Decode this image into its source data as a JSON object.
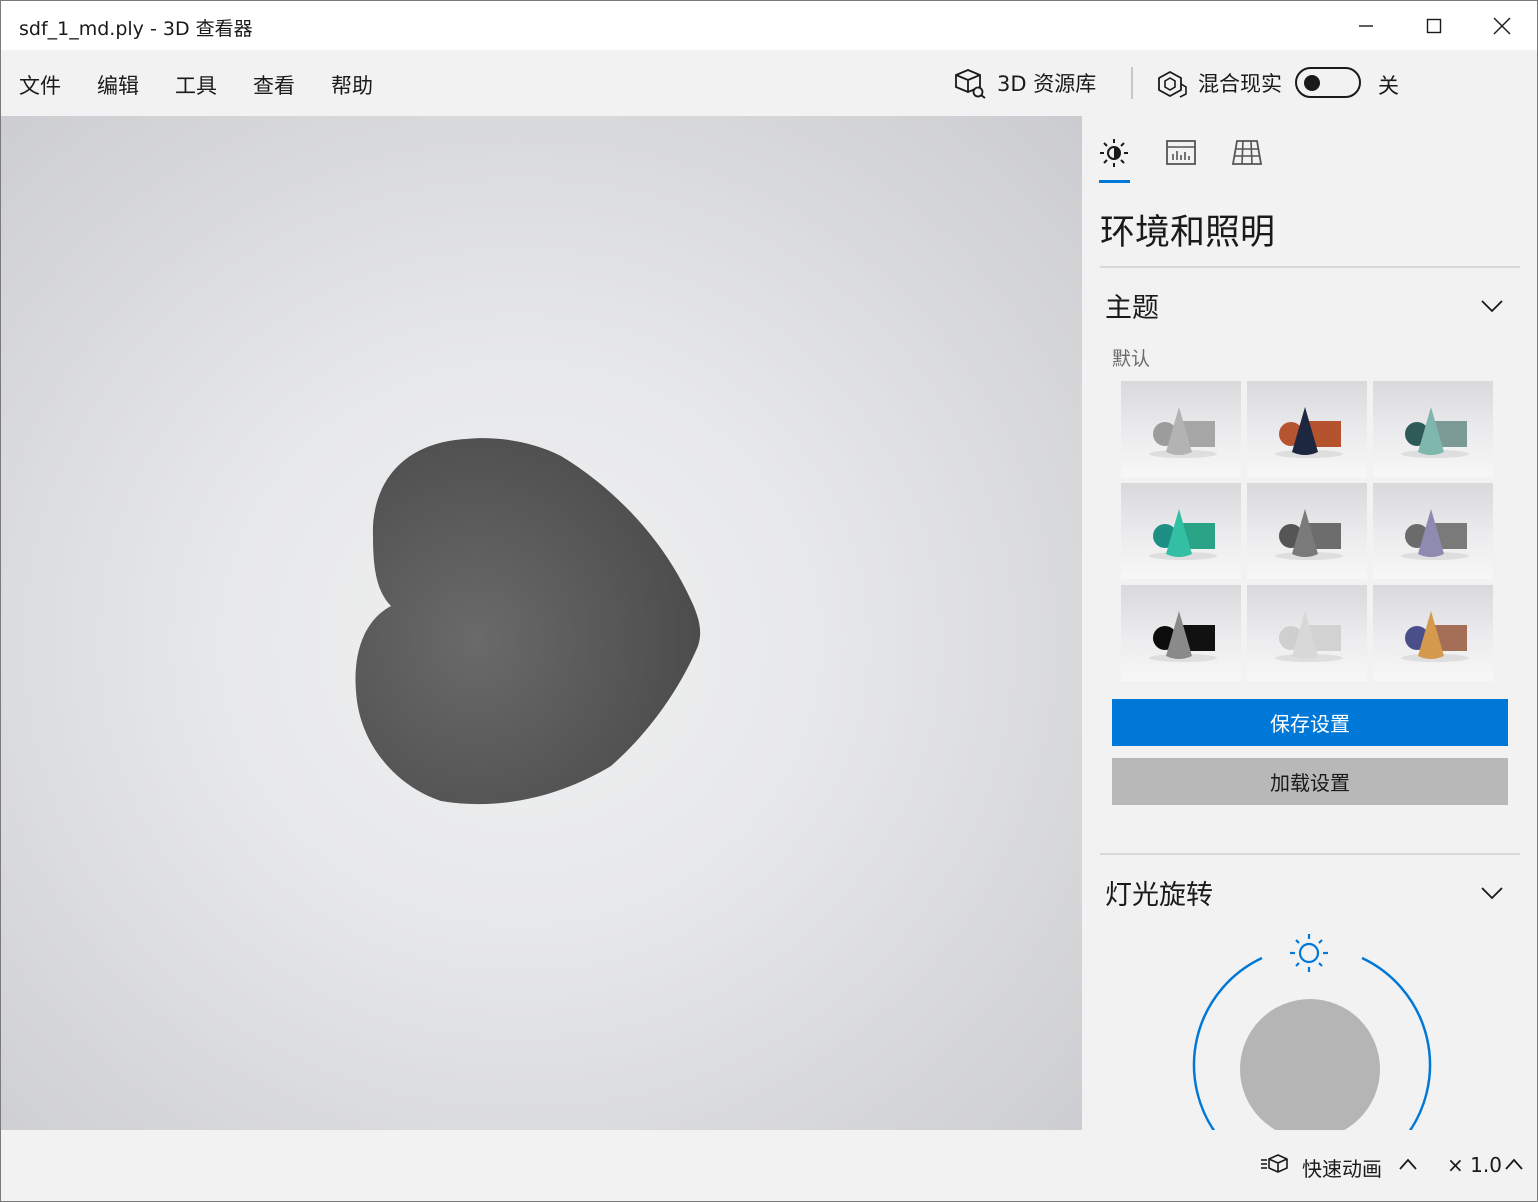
{
  "window": {
    "title": "sdf_1_md.ply - 3D 查看器"
  },
  "menu": {
    "items": [
      "文件",
      "编辑",
      "工具",
      "查看",
      "帮助"
    ],
    "library_label": "3D 资源库",
    "mixed_reality_label": "混合现实",
    "mixed_reality_state": "关"
  },
  "panel": {
    "active_tab": "lighting",
    "title": "环境和照明",
    "theme_section": {
      "title": "主题",
      "subtitle": "默认",
      "selected_index": 0,
      "themes": [
        {
          "sphere": "#9c9c9c",
          "cone": "#b3b3b3",
          "box": "#a6a6a6"
        },
        {
          "sphere": "#b5542e",
          "cone": "#1e2740",
          "box": "#b6532f"
        },
        {
          "sphere": "#2e5a57",
          "cone": "#7fb7ad",
          "box": "#7b9a95"
        },
        {
          "sphere": "#1e8f84",
          "cone": "#33bfa3",
          "box": "#2aa387"
        },
        {
          "sphere": "#555555",
          "cone": "#7a7a7a",
          "box": "#6d6d6d"
        },
        {
          "sphere": "#6b6b6b",
          "cone": "#8e8ab0",
          "box": "#7a7a7a"
        },
        {
          "sphere": "#0d0d0d",
          "cone": "#8a8a8a",
          "box": "#111111"
        },
        {
          "sphere": "#cfcfcf",
          "cone": "#d8d8d8",
          "box": "#d2d2d2"
        },
        {
          "sphere": "#4a4f8a",
          "cone": "#d59a4e",
          "box": "#a56f57"
        }
      ]
    },
    "save_button": "保存设置",
    "load_button": "加载设置",
    "light_section": {
      "title": "灯光旋转"
    }
  },
  "status": {
    "animation_label": "快速动画",
    "speed": "× 1.0"
  },
  "colors": {
    "accent": "#0078d7",
    "model": "#555555"
  }
}
